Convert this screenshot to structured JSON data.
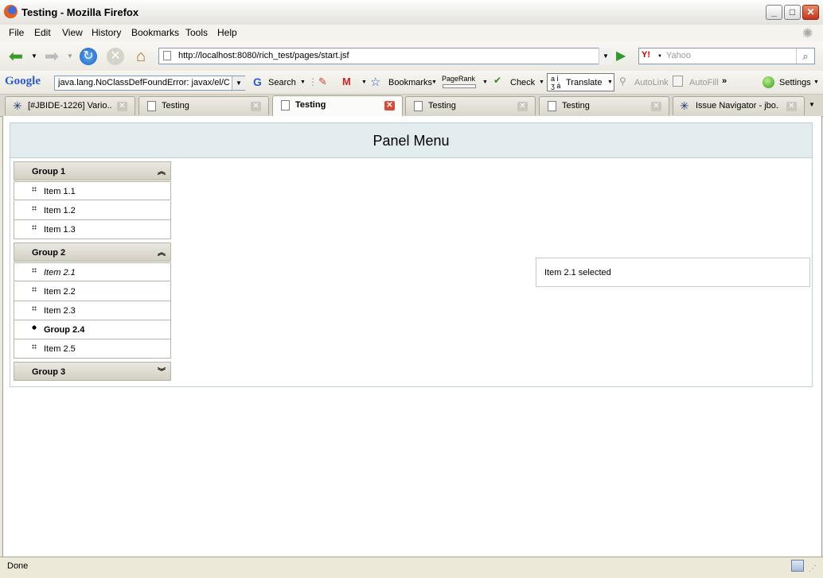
{
  "window": {
    "title": "Testing - Mozilla Firefox"
  },
  "menu": [
    "File",
    "Edit",
    "View",
    "History",
    "Bookmarks",
    "Tools",
    "Help"
  ],
  "nav": {
    "url": "http://localhost:8080/rich_test/pages/start.jsf",
    "search_placeholder": "Yahoo",
    "search_engine_icon": "Y!"
  },
  "google_toolbar": {
    "brand": "Google",
    "query": "java.lang.NoClassDefFoundError: javax/el/C",
    "search": "Search",
    "bookmarks": "Bookmarks",
    "pagerank": "PageRank",
    "check": "Check",
    "translate": "Translate",
    "autolink": "AutoLink",
    "autofill": "AutoFill",
    "settings": "Settings"
  },
  "tabs": [
    {
      "label": "[#JBIDE-1226] Vario..."
    },
    {
      "label": "Testing"
    },
    {
      "label": "Testing"
    },
    {
      "label": "Testing"
    },
    {
      "label": "Testing"
    },
    {
      "label": "Issue Navigator - jbo..."
    }
  ],
  "page": {
    "panel_title": "Panel Menu",
    "groups": [
      {
        "label": "Group 1",
        "items": [
          "Item 1.1",
          "Item 1.2",
          "Item 1.3"
        ]
      },
      {
        "label": "Group 2",
        "items": [
          "Item 2.1",
          "Item 2.2",
          "Item 2.3",
          "Group 2.4",
          "Item 2.5"
        ]
      },
      {
        "label": "Group 3",
        "items": []
      }
    ],
    "selection_text": "Item 2.1 selected"
  },
  "status": {
    "text": "Done"
  }
}
